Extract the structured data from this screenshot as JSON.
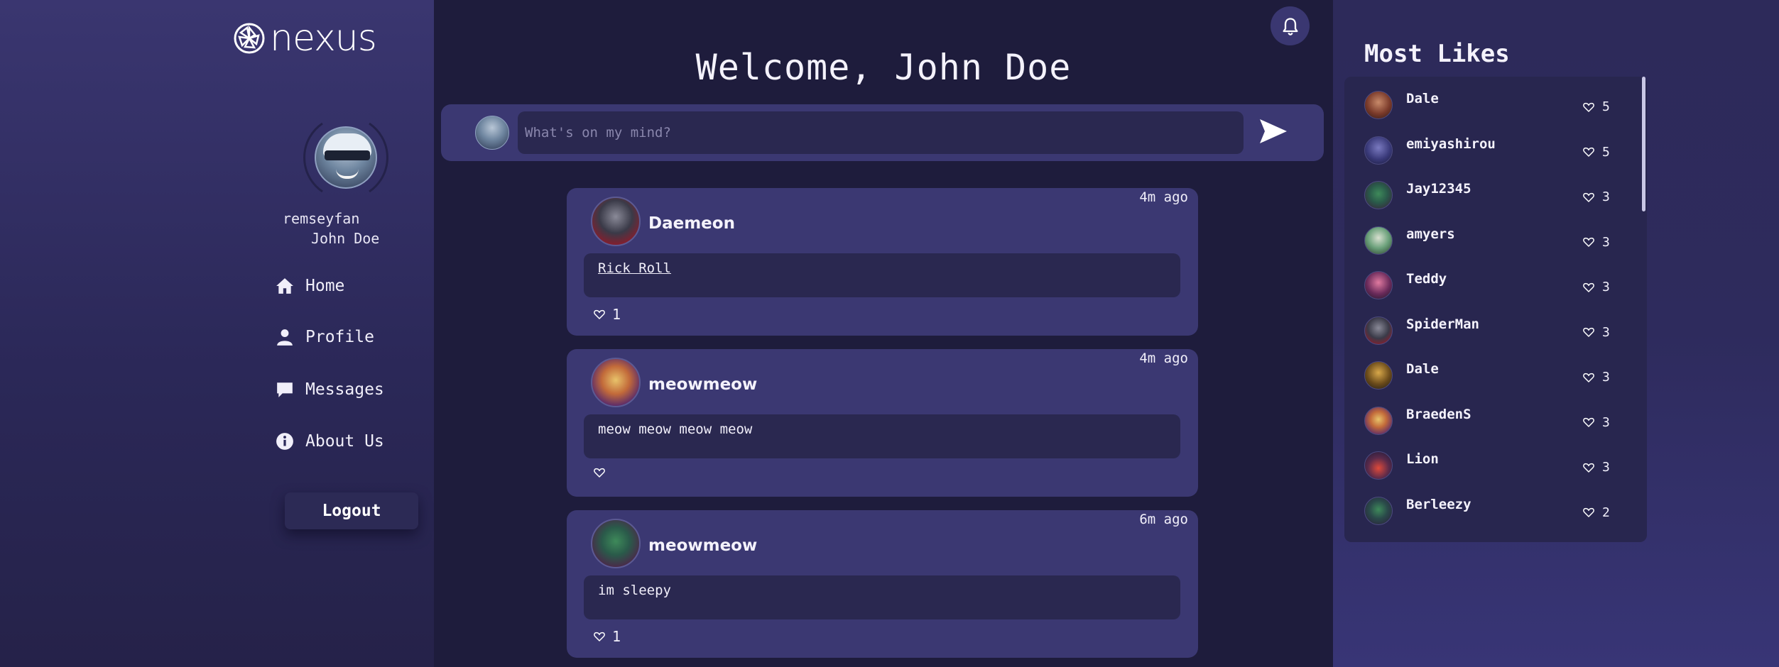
{
  "app": {
    "logo_text": "nexus"
  },
  "user": {
    "username": "remseyfan",
    "full_name": "John Doe"
  },
  "nav": [
    {
      "label": "Home",
      "icon": "home-icon"
    },
    {
      "label": "Profile",
      "icon": "user-icon"
    },
    {
      "label": "Messages",
      "icon": "chat-icon"
    },
    {
      "label": "About Us",
      "icon": "info-icon"
    }
  ],
  "logout_label": "Logout",
  "welcome": "Welcome, John Doe",
  "composer": {
    "placeholder": "What's on my mind?"
  },
  "posts": [
    {
      "author": "Daemeon",
      "time": "4m ago",
      "body": "Rick Roll",
      "body_is_link": true,
      "likes": "1"
    },
    {
      "author": "meowmeow",
      "time": "4m ago",
      "body": "meow meow meow meow",
      "body_is_link": false,
      "likes": ""
    },
    {
      "author": "meowmeow",
      "time": "6m ago",
      "body": "im sleepy",
      "body_is_link": false,
      "likes": "1"
    }
  ],
  "most_likes": {
    "title": "Most Likes",
    "items": [
      {
        "name": "Dale",
        "count": "5"
      },
      {
        "name": "emiyashirou",
        "count": "5"
      },
      {
        "name": "Jay12345",
        "count": "3"
      },
      {
        "name": "amyers",
        "count": "3"
      },
      {
        "name": "Teddy",
        "count": "3"
      },
      {
        "name": "SpiderMan",
        "count": "3"
      },
      {
        "name": "Dale",
        "count": "3"
      },
      {
        "name": "BraedenS",
        "count": "3"
      },
      {
        "name": "Lion",
        "count": "3"
      },
      {
        "name": "Berleezy",
        "count": "2"
      }
    ]
  },
  "colors": {
    "sidebar": "#3a3670",
    "main_bg": "#1e1c3c",
    "card": "#3b3872",
    "card_inner": "#2a2850"
  }
}
